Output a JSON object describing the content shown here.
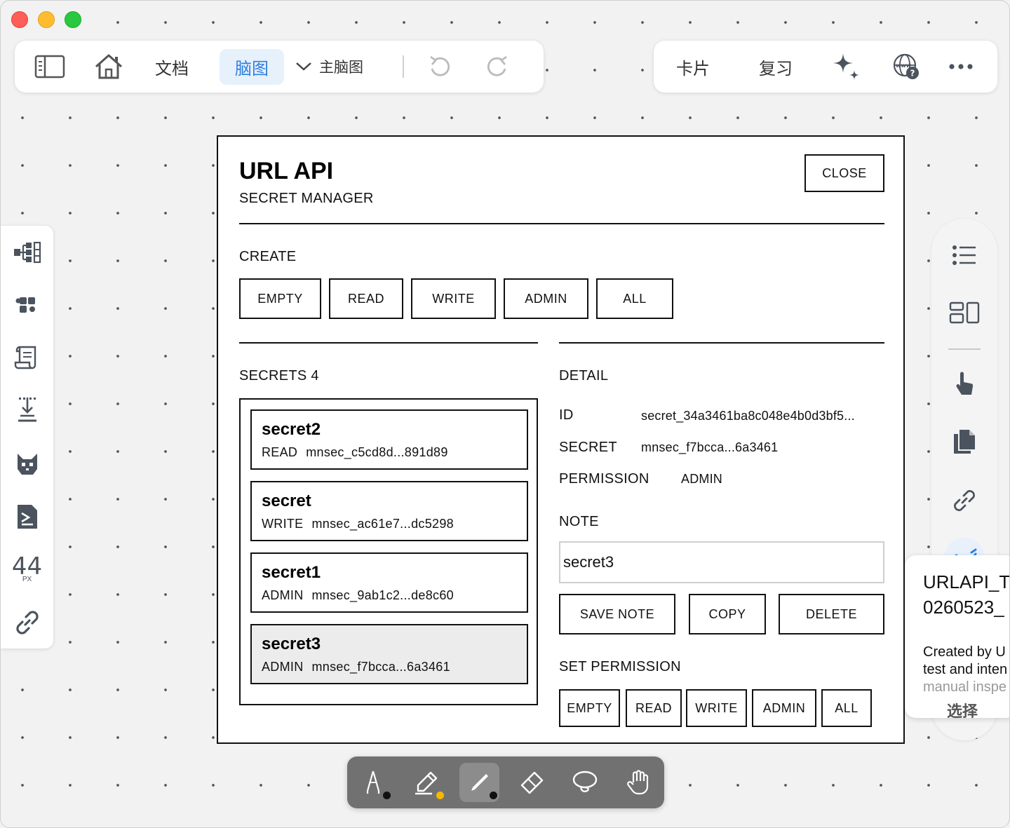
{
  "toolbar": {
    "docs_label": "文档",
    "mindmap_label": "脑图",
    "main_mindmap_label": "主脑图",
    "cards_label": "卡片",
    "review_label": "复习"
  },
  "side_left": {
    "px_value": "44",
    "px_unit": "PX"
  },
  "modal": {
    "title": "URL API",
    "subtitle": "SECRET MANAGER",
    "close_label": "CLOSE",
    "create_label": "CREATE",
    "create_buttons": [
      "EMPTY",
      "READ",
      "WRITE",
      "ADMIN",
      "ALL"
    ],
    "secrets_label": "SECRETS 4",
    "secrets": [
      {
        "name": "secret2",
        "permission": "READ",
        "key": "mnsec_c5cd8d...891d89"
      },
      {
        "name": "secret",
        "permission": "WRITE",
        "key": "mnsec_ac61e7...dc5298"
      },
      {
        "name": "secret1",
        "permission": "ADMIN",
        "key": "mnsec_9ab1c2...de8c60"
      },
      {
        "name": "secret3",
        "permission": "ADMIN",
        "key": "mnsec_f7bcca...6a3461"
      }
    ],
    "detail": {
      "label": "DETAIL",
      "id_label": "ID",
      "id_value": "secret_34a3461ba8c048e4b0d3bf5...",
      "secret_label": "SECRET",
      "secret_value": "mnsec_f7bcca...6a3461",
      "permission_label": "PERMISSION",
      "permission_value": "ADMIN",
      "note_label": "NOTE",
      "note_value": "secret3",
      "save_label": "SAVE NOTE",
      "copy_label": "COPY",
      "delete_label": "DELETE",
      "set_permission_label": "SET PERMISSION",
      "permission_buttons": [
        "EMPTY",
        "READ",
        "WRITE",
        "ADMIN",
        "ALL"
      ]
    }
  },
  "card": {
    "title_line1": "URLAPI_T",
    "title_line2": "0260523_",
    "desc_line1": "Created by U",
    "desc_line2": "test and inten",
    "desc_line3": "manual inspe",
    "select_label": "选择"
  },
  "colors": {
    "accent": "#2f7fe0",
    "accent_bg": "#e6f1fc",
    "pen_dot_yellow": "#f5b800",
    "pen_dot_black": "#111111"
  },
  "icons": {
    "toolbar": [
      "sidebar-toggle-icon",
      "home-icon",
      "chevron-down-icon",
      "undo-icon",
      "redo-icon",
      "sparkle-icon",
      "web-help-icon",
      "more-icon"
    ],
    "left": [
      "mindmap-structure-icon",
      "puzzle-icon",
      "scroll-icon",
      "download-icon",
      "cat-icon",
      "document-chart-icon",
      "link-icon"
    ],
    "right": [
      "list-icon",
      "layout-icon",
      "pointer-hand-icon",
      "copy-icon",
      "link-icon",
      "handwriting-icon"
    ],
    "draw": [
      "fountain-pen-icon",
      "highlighter-icon",
      "pencil-icon",
      "eraser-icon",
      "lasso-icon",
      "hand-icon"
    ]
  }
}
